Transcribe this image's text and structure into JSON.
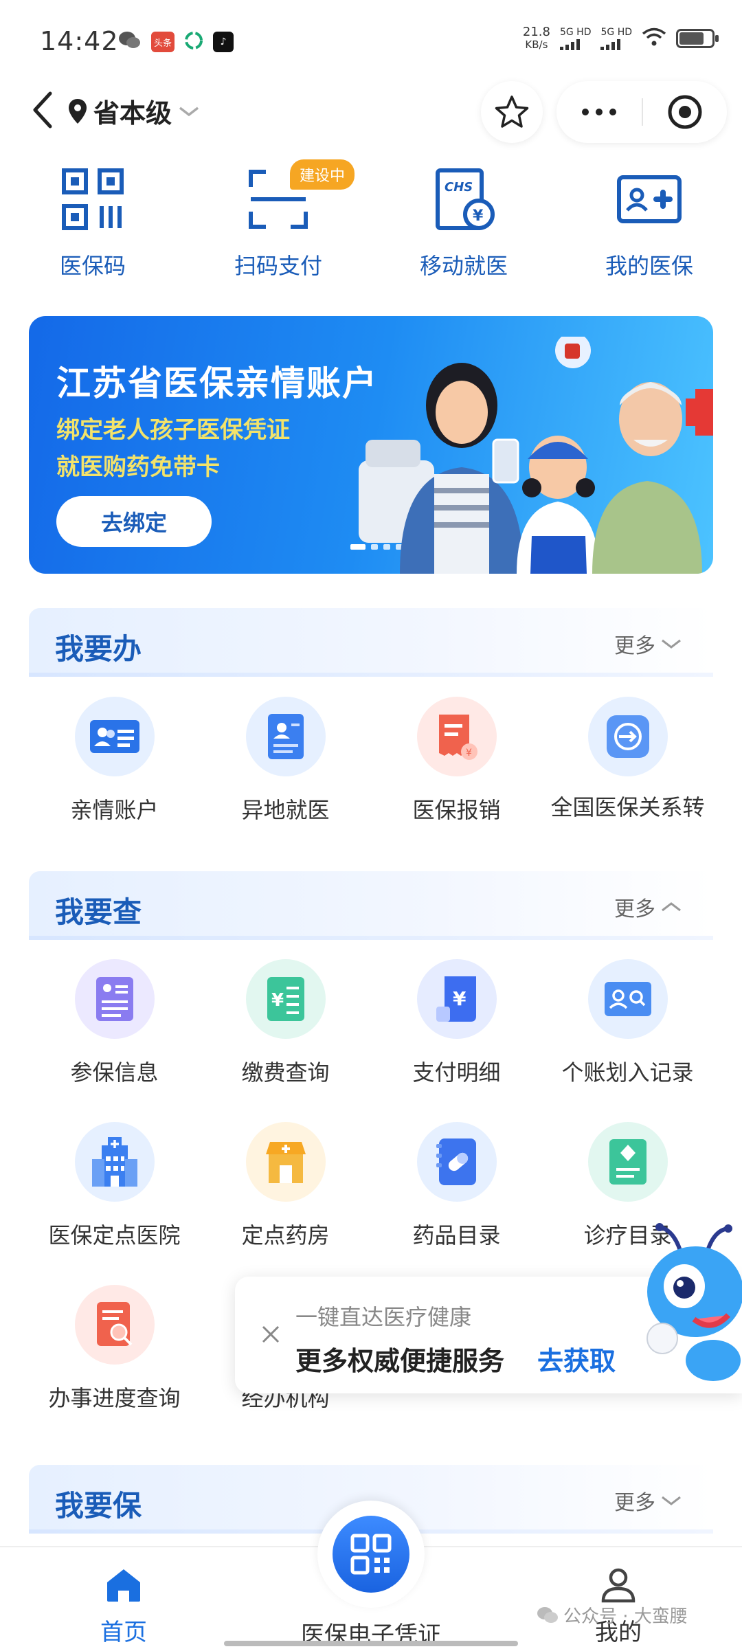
{
  "status_bar": {
    "time": "14:42",
    "net_speed_value": "21.8",
    "net_speed_unit": "KB/s",
    "sim1": "5G HD",
    "sim2": "5G HD",
    "app_badge_text": "头条"
  },
  "nav": {
    "location": "省本级"
  },
  "shortcuts": [
    {
      "label": "医保码",
      "icon": "qr-code-icon"
    },
    {
      "label": "扫码支付",
      "icon": "scan-icon",
      "badge": "建设中"
    },
    {
      "label": "移动就医",
      "icon": "chs-card-icon",
      "card_text": "CHS"
    },
    {
      "label": "我的医保",
      "icon": "medical-card-icon"
    }
  ],
  "banner": {
    "title": "江苏省医保亲情账户",
    "line1": "绑定老人孩子医保凭证",
    "line2": "就医购药免带卡",
    "button": "去绑定"
  },
  "section_handle": {
    "title": "我要办",
    "more": "更多",
    "items": [
      {
        "label": "亲情账户",
        "icon": "family-account-icon"
      },
      {
        "label": "异地就医",
        "icon": "remote-medical-icon"
      },
      {
        "label": "医保报销",
        "icon": "reimbursement-icon"
      },
      {
        "label": "全国医保关系转移",
        "icon": "transfer-icon"
      }
    ]
  },
  "section_query": {
    "title": "我要查",
    "more": "更多",
    "row1": [
      {
        "label": "参保信息",
        "icon": "insurance-info-icon"
      },
      {
        "label": "缴费查询",
        "icon": "payment-query-icon"
      },
      {
        "label": "支付明细",
        "icon": "payment-detail-icon"
      },
      {
        "label": "个账划入记录",
        "icon": "account-record-icon"
      }
    ],
    "row2": [
      {
        "label": "医保定点医院",
        "icon": "hospital-icon"
      },
      {
        "label": "定点药房",
        "icon": "pharmacy-icon"
      },
      {
        "label": "药品目录",
        "icon": "drug-catalog-icon"
      },
      {
        "label": "诊疗目录",
        "icon": "treatment-catalog-icon"
      }
    ],
    "row3": [
      {
        "label": "办事进度查询",
        "icon": "progress-query-icon"
      },
      {
        "label": "经办机构",
        "icon": "agency-icon"
      }
    ]
  },
  "promo": {
    "line1": "一键直达医疗健康",
    "line2": "更多权威便捷服务",
    "cta": "去获取"
  },
  "section_protect": {
    "title": "我要保",
    "more": "更多"
  },
  "tabbar": {
    "home": "首页",
    "center": "医保电子凭证",
    "mine": "我的"
  },
  "watermark": "公众号 · 大蛮腰",
  "colors": {
    "brand_blue": "#1a5cb8",
    "accent_blue": "#1a6fe0",
    "badge_orange": "#f6a623",
    "banner_yellow": "#f3e36a"
  }
}
